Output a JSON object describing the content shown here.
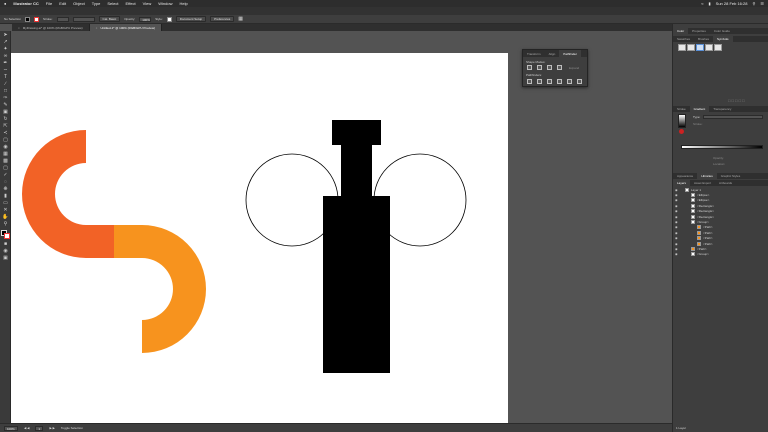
{
  "menubar": {
    "apple": "",
    "app": "Illustrator CC",
    "items": [
      "File",
      "Edit",
      "Object",
      "Type",
      "Select",
      "Effect",
      "View",
      "Window",
      "Help"
    ],
    "clock": "Sun 28 Feb 16:28"
  },
  "workspace": "Essentials Classic",
  "control_bar": {
    "selection": "No Selection",
    "stroke_label": "Stroke:",
    "style_label": "Style:",
    "opacity_label": "Opacity:",
    "opacity_value": "100%",
    "style2_label": "Style:",
    "doc_setup": "Document Setup",
    "preferences": "Preferences",
    "basic_label": "Cat. Basic"
  },
  "tabs": [
    {
      "label": "MyDrawing.ai* @ 100% (RGB/GPU Preview)",
      "active": false
    },
    {
      "label": "Untitled-1* @ 100% (RGB/GPU Preview)",
      "active": true
    }
  ],
  "statusbar": {
    "zoom": "100%",
    "page": "1",
    "tool": "Toggle Selection"
  },
  "right_panel": {
    "top_tabs": [
      "Color",
      "Properties",
      "Color Guide"
    ],
    "swatch_tabs": [
      "Swatches",
      "Brushes",
      "Symbols"
    ],
    "stroke_tabs": [
      "Stroke",
      "Gradient",
      "Transparency"
    ],
    "gradient_type_label": "Type:",
    "gradient_stroke_label": "Stroke:",
    "opacity_label": "Opacity:",
    "location_label": "Location:",
    "layers_tabs": [
      "Appearance",
      "Libraries",
      "Graphic Styles"
    ],
    "layers_subtabs": [
      "Layers",
      "Asset Export",
      "Artboards"
    ],
    "layers": [
      {
        "name": "Layer 1",
        "indent": 0
      },
      {
        "name": "<Ellipse>",
        "indent": 1
      },
      {
        "name": "<Ellipse>",
        "indent": 1
      },
      {
        "name": "<Rectangle>",
        "indent": 1
      },
      {
        "name": "<Rectangle>",
        "indent": 1
      },
      {
        "name": "<Rectangle>",
        "indent": 1
      },
      {
        "name": "<Group>",
        "indent": 1
      },
      {
        "name": "<Path>",
        "indent": 2
      },
      {
        "name": "<Path>",
        "indent": 2
      },
      {
        "name": "<Path>",
        "indent": 2
      },
      {
        "name": "<Path>",
        "indent": 2
      },
      {
        "name": "<Path>",
        "indent": 1
      },
      {
        "name": "<Group>",
        "indent": 1
      }
    ],
    "layers_count": "1 Layer"
  },
  "pathfinder": {
    "tabs": [
      "Transform",
      "Align",
      "Pathfinder"
    ],
    "shape_modes": "Shape Modes:",
    "pathfinders": "Pathfinders:",
    "expand": "Expand"
  },
  "colors": {
    "orange_dark": "#F26226",
    "orange_light": "#F7931E",
    "black": "#000000",
    "artboard": "#FFFFFF"
  }
}
